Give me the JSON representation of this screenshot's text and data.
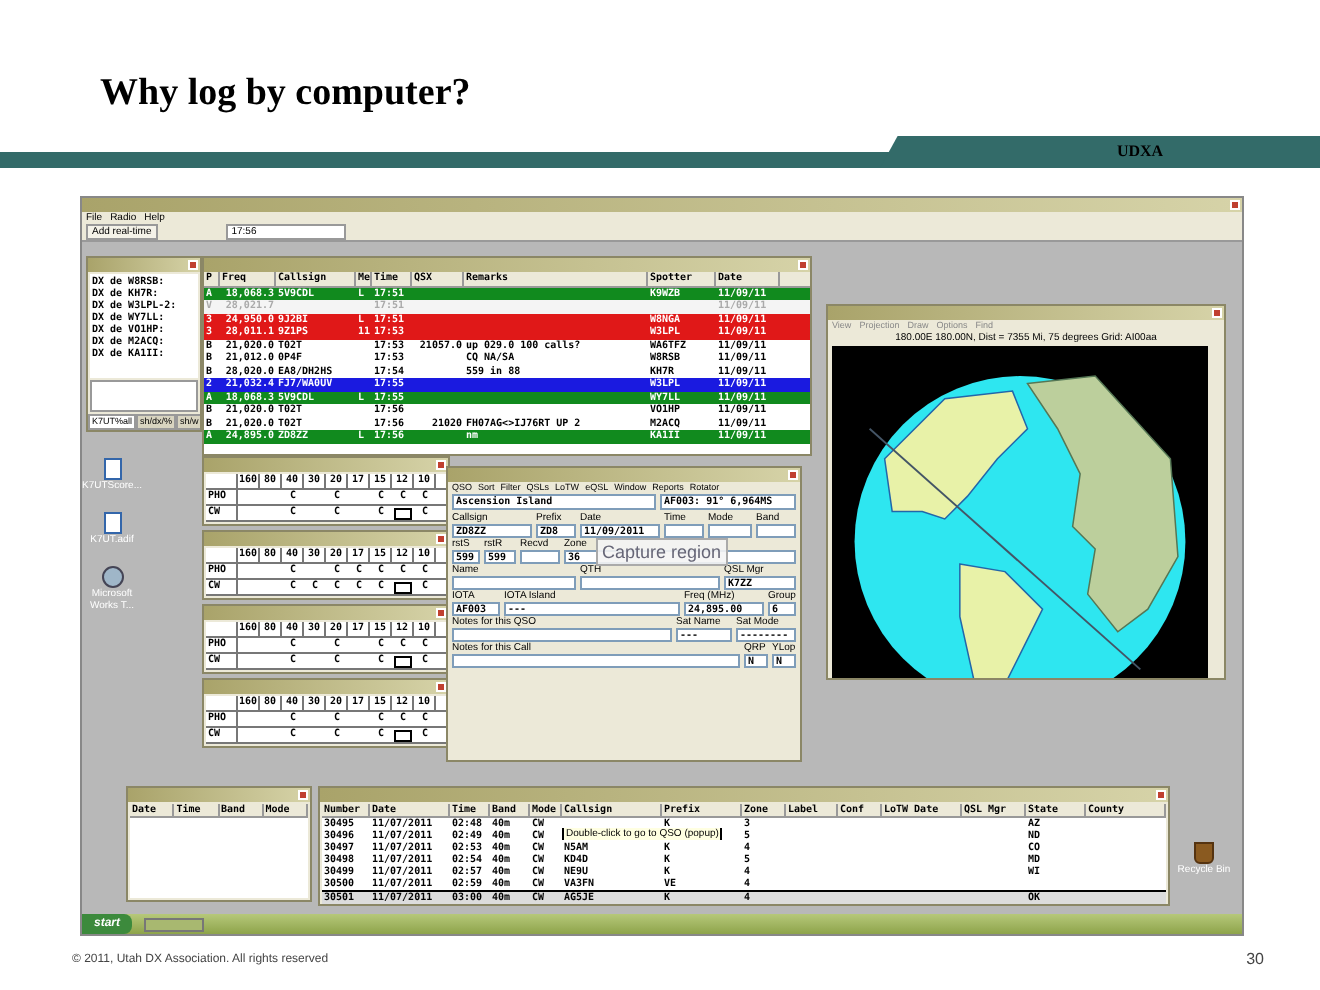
{
  "slide": {
    "title": "Why log by computer?",
    "banner": "UDXA",
    "footer": "© 2011, Utah DX Association.  All rights reserved",
    "page_number": "30"
  },
  "app": {
    "menu": [
      "File",
      "Radio",
      "Help"
    ],
    "toolbar": {
      "button": "Add real-time",
      "time": "17:56"
    }
  },
  "dx_window": {
    "lines": [
      "DX de W8RSB:",
      "DX de KH7R:",
      "DX de W3LPL-2:",
      "DX de WY7LL:",
      "DX de VO1HP:",
      "DX de M2ACQ:",
      "DX de KA1II:"
    ],
    "tabs": [
      {
        "label": "K7UT%all",
        "selected": true
      },
      {
        "label": "sh/dx/%",
        "selected": false
      },
      {
        "label": "sh/w",
        "selected": false
      }
    ]
  },
  "spots": {
    "columns": [
      "P",
      "Freq",
      "Callsign",
      "Me",
      "Time",
      "QSX",
      "Remarks",
      "Spotter",
      "Date"
    ],
    "rows": [
      {
        "color": "#118a1e",
        "p": "A",
        "freq": "18,068.3",
        "callsign": "5V9CDL",
        "me": "L",
        "time": "17:51",
        "spotter": "K9WZB",
        "date": "11/09/11"
      },
      {
        "color": "#f4f4f4",
        "p": "V",
        "freq": "28,021.7",
        "time": "17:51",
        "date": "11/09/11"
      },
      {
        "color": "#e01818",
        "p": "3",
        "freq": "24,950.0",
        "callsign": "9J2BI",
        "me": "L",
        "time": "17:51",
        "spotter": "W8NGA",
        "date": "11/09/11"
      },
      {
        "color": "#e01818",
        "p": "3",
        "freq": "28,011.1",
        "callsign": "9Z1PS",
        "me": "11",
        "time": "17:53",
        "spotter": "W3LPL",
        "date": "11/09/11"
      },
      {
        "color": "#ffffff",
        "p": "B",
        "freq": "21,020.0",
        "callsign": "T02T",
        "time": "17:53",
        "qsx": "21057.0",
        "remarks": "up 029.0 100 calls?",
        "spotter": "WA6TFZ",
        "date": "11/09/11"
      },
      {
        "color": "#ffffff",
        "p": "B",
        "freq": "21,012.0",
        "callsign": "0P4F",
        "time": "17:53",
        "remarks": "CQ NA/SA",
        "spotter": "W8RSB",
        "date": "11/09/11"
      },
      {
        "color": "#ffffff",
        "p": "B",
        "freq": "28,020.0",
        "callsign": "EA8/DH2HS",
        "time": "17:54",
        "remarks": "559 in 88",
        "spotter": "KH7R",
        "date": "11/09/11"
      },
      {
        "color": "#1a1ae0",
        "p": "2",
        "freq": "21,032.4",
        "callsign": "FJ7/WA0UV",
        "time": "17:55",
        "spotter": "W3LPL",
        "date": "11/09/11"
      },
      {
        "color": "#118a1e",
        "p": "A",
        "freq": "18,068.3",
        "callsign": "5V9CDL",
        "me": "L",
        "time": "17:55",
        "spotter": "WY7LL",
        "date": "11/09/11"
      },
      {
        "color": "#ffffff",
        "p": "B",
        "freq": "21,020.0",
        "callsign": "T02T",
        "time": "17:56",
        "spotter": "VO1HP",
        "date": "11/09/11"
      },
      {
        "color": "#ffffff",
        "p": "B",
        "freq": "21,020.0",
        "callsign": "T02T",
        "time": "17:56",
        "qsx": "21020",
        "remarks": "FH07AG<>IJ76RT UP 2",
        "spotter": "M2ACQ",
        "date": "11/09/11"
      },
      {
        "color": "#118a1e",
        "p": "A",
        "freq": "24,895.0",
        "callsign": "ZD8ZZ",
        "me": "L",
        "time": "17:56",
        "remarks": "nm",
        "spotter": "KA1II",
        "date": "11/09/11"
      }
    ]
  },
  "desktop_icons": [
    {
      "kind": "document",
      "label": "K7UTScore..."
    },
    {
      "kind": "document",
      "label": "K7UT.adif"
    },
    {
      "kind": "program",
      "label": "Microsoft Works T..."
    },
    {
      "kind": "recycle",
      "label": "Recycle Bin"
    }
  ],
  "band_windows": [
    {
      "bands": [
        "160",
        "80",
        "40",
        "30",
        "20",
        "17",
        "15",
        "12",
        "10"
      ],
      "rows": [
        {
          "label": "PHO",
          "marks": [
            {
              "kind": "blank"
            },
            {
              "kind": "blank"
            },
            {
              "kind": "mark",
              "text": "C"
            },
            {
              "kind": "blank"
            },
            {
              "kind": "mark",
              "text": "C"
            },
            {
              "kind": "blank"
            },
            {
              "kind": "mark",
              "text": "C"
            },
            {
              "kind": "mark",
              "text": "C"
            },
            {
              "kind": "mark",
              "text": "C"
            }
          ]
        },
        {
          "label": "CW",
          "marks": [
            {
              "kind": "blank"
            },
            {
              "kind": "blank"
            },
            {
              "kind": "mark",
              "text": "C"
            },
            {
              "kind": "blank"
            },
            {
              "kind": "mark",
              "text": "C"
            },
            {
              "kind": "blank"
            },
            {
              "kind": "mark",
              "text": "C"
            },
            {
              "kind": "box"
            },
            {
              "kind": "mark",
              "text": "C"
            }
          ]
        }
      ]
    },
    {
      "bands": [
        "160",
        "80",
        "40",
        "30",
        "20",
        "17",
        "15",
        "12",
        "10"
      ],
      "rows": [
        {
          "label": "PHO",
          "marks": [
            {
              "kind": "blank"
            },
            {
              "kind": "blank"
            },
            {
              "kind": "mark",
              "text": "C"
            },
            {
              "kind": "blank"
            },
            {
              "kind": "mark",
              "text": "C"
            },
            {
              "kind": "mark",
              "text": "C"
            },
            {
              "kind": "mark",
              "text": "C"
            },
            {
              "kind": "mark",
              "text": "C"
            },
            {
              "kind": "mark",
              "text": "C"
            }
          ]
        },
        {
          "label": "CW",
          "marks": [
            {
              "kind": "blank"
            },
            {
              "kind": "blank"
            },
            {
              "kind": "mark",
              "text": "C"
            },
            {
              "kind": "mark",
              "text": "C"
            },
            {
              "kind": "mark",
              "text": "C"
            },
            {
              "kind": "mark",
              "text": "C"
            },
            {
              "kind": "mark",
              "text": "C"
            },
            {
              "kind": "box"
            },
            {
              "kind": "mark",
              "text": "C"
            }
          ]
        }
      ]
    },
    {
      "bands": [
        "160",
        "80",
        "40",
        "30",
        "20",
        "17",
        "15",
        "12",
        "10"
      ],
      "rows": [
        {
          "label": "PHO",
          "marks": [
            {
              "kind": "blank"
            },
            {
              "kind": "blank"
            },
            {
              "kind": "mark",
              "text": "C"
            },
            {
              "kind": "blank"
            },
            {
              "kind": "mark",
              "text": "C"
            },
            {
              "kind": "blank"
            },
            {
              "kind": "mark",
              "text": "C"
            },
            {
              "kind": "mark",
              "text": "C"
            },
            {
              "kind": "mark",
              "text": "C"
            }
          ]
        },
        {
          "label": "CW",
          "marks": [
            {
              "kind": "blank"
            },
            {
              "kind": "blank"
            },
            {
              "kind": "mark",
              "text": "C"
            },
            {
              "kind": "blank"
            },
            {
              "kind": "mark",
              "text": "C"
            },
            {
              "kind": "blank"
            },
            {
              "kind": "mark",
              "text": "C"
            },
            {
              "kind": "box"
            },
            {
              "kind": "mark",
              "text": "C"
            }
          ]
        }
      ]
    },
    {
      "bands": [
        "160",
        "80",
        "40",
        "30",
        "20",
        "17",
        "15",
        "12",
        "10"
      ],
      "rows": [
        {
          "label": "PHO",
          "marks": [
            {
              "kind": "blank"
            },
            {
              "kind": "blank"
            },
            {
              "kind": "mark",
              "text": "C"
            },
            {
              "kind": "blank"
            },
            {
              "kind": "mark",
              "text": "C"
            },
            {
              "kind": "blank"
            },
            {
              "kind": "mark",
              "text": "C"
            },
            {
              "kind": "mark",
              "text": "C"
            },
            {
              "kind": "mark",
              "text": "C"
            }
          ]
        },
        {
          "label": "CW",
          "marks": [
            {
              "kind": "blank"
            },
            {
              "kind": "blank"
            },
            {
              "kind": "mark",
              "text": "C"
            },
            {
              "kind": "blank"
            },
            {
              "kind": "mark",
              "text": "C"
            },
            {
              "kind": "blank"
            },
            {
              "kind": "mark",
              "text": "C"
            },
            {
              "kind": "box"
            },
            {
              "kind": "mark",
              "text": "C"
            }
          ]
        }
      ]
    }
  ],
  "qso_window": {
    "menu": [
      "QSO",
      "Sort",
      "Filter",
      "QSLs",
      "LoTW",
      "eQSL",
      "Window",
      "Reports",
      "Rotator"
    ],
    "country": "Ascension Island",
    "bearing": "AF003: 91° 6,964MS",
    "row1": [
      {
        "label": "Callsign",
        "value": "ZD8ZZ"
      },
      {
        "label": "Prefix",
        "value": "ZD8"
      },
      {
        "label": "Date",
        "value": "11/09/2011"
      },
      {
        "label": "Time"
      },
      {
        "label": "Mode"
      },
      {
        "label": "Band"
      }
    ],
    "row2": [
      {
        "label": "rstS",
        "value": "599"
      },
      {
        "label": "rstR",
        "value": "599"
      },
      {
        "label": "Recvd"
      },
      {
        "label": "Zone",
        "value": "36"
      }
    ],
    "tooltip": "Capture region",
    "row3": [
      {
        "label": "Name"
      },
      {
        "label": "QTH"
      },
      {
        "label": "QSL Mgr",
        "value": "K7ZZ"
      }
    ],
    "row4": [
      {
        "label": "IOTA",
        "value": "AF003"
      },
      {
        "label": "IOTA Island",
        "value": "---"
      },
      {
        "label": "Freq (MHz)",
        "value": "24,895.00"
      },
      {
        "label": "Group",
        "value": "6"
      }
    ],
    "row5": [
      {
        "label": "Notes for this QSO"
      },
      {
        "label": "Sat Name",
        "value": "---"
      },
      {
        "label": "Sat Mode",
        "value": "--------"
      }
    ],
    "row6": [
      {
        "label": "Notes for this Call"
      },
      {
        "label": "QRP",
        "value": "N"
      },
      {
        "label": "YLop",
        "value": "N"
      }
    ]
  },
  "map_window": {
    "menu": [
      "View",
      "Projection",
      "Draw",
      "Options",
      "Find"
    ],
    "status": "180.00E 180.00N, Dist = 7355 Mi, 75 degrees Grid: AI00aa"
  },
  "other_qsos": {
    "columns": [
      "Date",
      "Time",
      "Band",
      "Mode"
    ]
  },
  "logbook": {
    "columns": [
      "Number",
      "Date",
      "Time",
      "Band",
      "Mode",
      "Callsign",
      "Prefix",
      "Zone",
      "Label",
      "Conf",
      "LoTW Date",
      "QSL Mgr",
      "State",
      "County"
    ],
    "rows": [
      {
        "selected": false,
        "number": "30495",
        "date": "11/07/2011",
        "time": "02:48",
        "band": "40m",
        "mode": "CW",
        "prefix": "K",
        "zone": "3",
        "state": "AZ"
      },
      {
        "selected": false,
        "number": "30496",
        "date": "11/07/2011",
        "time": "02:49",
        "band": "40m",
        "mode": "CW",
        "zone": "5",
        "state": "ND"
      },
      {
        "selected": false,
        "number": "30497",
        "date": "11/07/2011",
        "time": "02:53",
        "band": "40m",
        "mode": "CW",
        "callsign": "N5AM",
        "prefix": "K",
        "zone": "4",
        "state": "CO"
      },
      {
        "selected": false,
        "number": "30498",
        "date": "11/07/2011",
        "time": "02:54",
        "band": "40m",
        "mode": "CW",
        "callsign": "KD4D",
        "prefix": "K",
        "zone": "5",
        "state": "MD"
      },
      {
        "selected": false,
        "number": "30499",
        "date": "11/07/2011",
        "time": "02:57",
        "band": "40m",
        "mode": "CW",
        "callsign": "NE9U",
        "prefix": "K",
        "zone": "4",
        "state": "WI"
      },
      {
        "selected": false,
        "number": "30500",
        "date": "11/07/2011",
        "time": "02:59",
        "band": "40m",
        "mode": "CW",
        "callsign": "VA3FN",
        "prefix": "VE",
        "zone": "4"
      },
      {
        "selected": true,
        "number": "30501",
        "date": "11/07/2011",
        "time": "03:00",
        "band": "40m",
        "mode": "CW",
        "callsign": "AG5JE",
        "prefix": "K",
        "zone": "4",
        "state": "OK"
      }
    ],
    "tooltip": "Double-click to go to QSO (popup)"
  },
  "taskbar": {
    "start": "start"
  }
}
